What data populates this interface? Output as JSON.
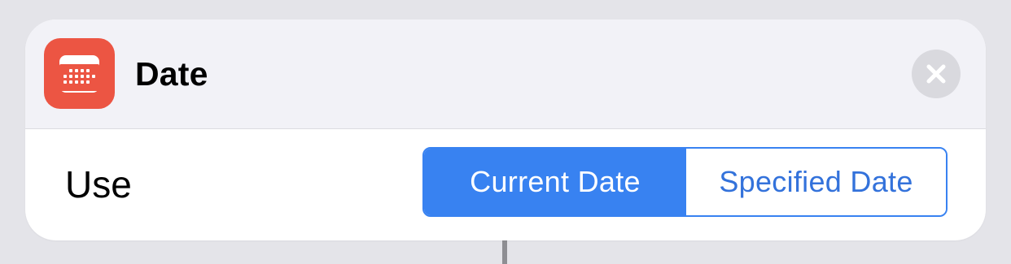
{
  "action": {
    "title": "Date",
    "icon": "calendar-icon",
    "icon_color": "#ec5543"
  },
  "close": {
    "icon": "close-icon"
  },
  "parameter": {
    "label": "Use",
    "options": [
      "Current Date",
      "Specified Date"
    ],
    "selected": "Current Date"
  },
  "colors": {
    "accent": "#3882f1",
    "header_bg": "#f2f2f7",
    "background": "#e4e4e9"
  }
}
